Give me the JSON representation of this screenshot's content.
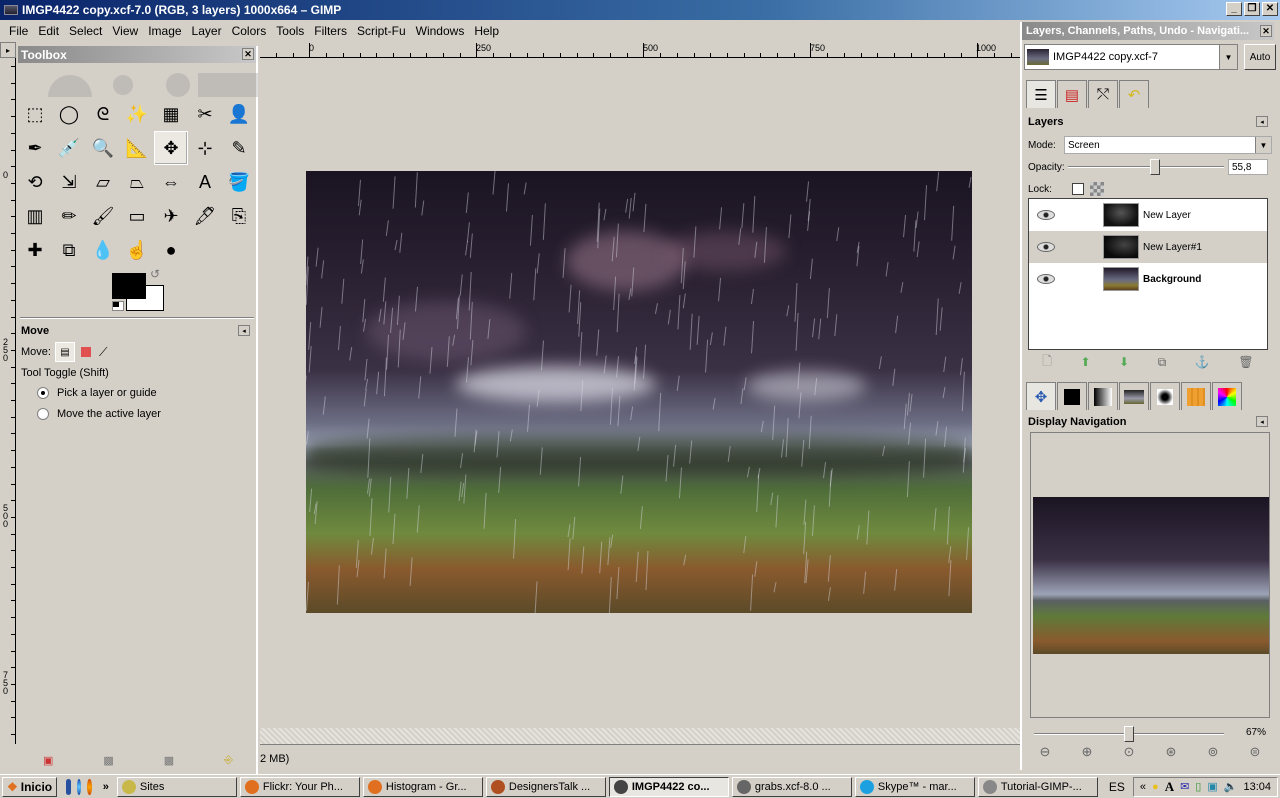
{
  "window": {
    "title": "IMGP4422 copy.xcf-7.0 (RGB, 3 layers) 1000x664 – GIMP",
    "controls": [
      "minimize",
      "restore",
      "close"
    ]
  },
  "menubar": {
    "items": [
      "File",
      "Edit",
      "Select",
      "View",
      "Image",
      "Layer",
      "Colors",
      "Tools",
      "Filters",
      "Script-Fu",
      "Windows",
      "Help"
    ]
  },
  "rulers": {
    "horizontal": [
      "0",
      "250",
      "500",
      "750",
      "1000"
    ],
    "vertical": [
      "0",
      "250",
      "500",
      "750"
    ]
  },
  "toolbox": {
    "title": "Toolbox",
    "tools": [
      {
        "name": "rect-select",
        "glyph": "⬚"
      },
      {
        "name": "ellipse-select",
        "glyph": "◯"
      },
      {
        "name": "free-select",
        "glyph": "ᘓ"
      },
      {
        "name": "fuzzy-select",
        "glyph": "✨"
      },
      {
        "name": "select-by-color",
        "glyph": "▦"
      },
      {
        "name": "scissors",
        "glyph": "✂"
      },
      {
        "name": "foreground-select",
        "glyph": "👤"
      },
      {
        "name": "paths",
        "glyph": "✒"
      },
      {
        "name": "color-picker",
        "glyph": "💉"
      },
      {
        "name": "zoom",
        "glyph": "🔍"
      },
      {
        "name": "measure",
        "glyph": "📐"
      },
      {
        "name": "move",
        "glyph": "✥"
      },
      {
        "name": "align",
        "glyph": "⊹"
      },
      {
        "name": "crop",
        "glyph": "✎"
      },
      {
        "name": "rotate",
        "glyph": "⟲"
      },
      {
        "name": "scale",
        "glyph": "⇲"
      },
      {
        "name": "shear",
        "glyph": "▱"
      },
      {
        "name": "perspective",
        "glyph": "⏢"
      },
      {
        "name": "flip",
        "glyph": "⇔"
      },
      {
        "name": "text",
        "glyph": "A"
      },
      {
        "name": "bucket-fill",
        "glyph": "🪣"
      },
      {
        "name": "blend",
        "glyph": "▥"
      },
      {
        "name": "pencil",
        "glyph": "✏"
      },
      {
        "name": "paintbrush",
        "glyph": "🖌"
      },
      {
        "name": "eraser",
        "glyph": "▭"
      },
      {
        "name": "airbrush",
        "glyph": "✈"
      },
      {
        "name": "ink",
        "glyph": "🖋"
      },
      {
        "name": "clone",
        "glyph": "⎘"
      },
      {
        "name": "heal",
        "glyph": "✚"
      },
      {
        "name": "perspective-clone",
        "glyph": "⧉"
      },
      {
        "name": "blur-sharpen",
        "glyph": "💧"
      },
      {
        "name": "smudge",
        "glyph": "☝"
      },
      {
        "name": "dodge-burn",
        "glyph": "●"
      }
    ],
    "active_tool": "move",
    "fg_color": "#000000",
    "bg_color": "#ffffff",
    "tool_options": {
      "title": "Move",
      "move_label": "Move:",
      "toggle_label": "Tool Toggle  (Shift)",
      "options": [
        {
          "label": "Pick a layer or guide",
          "selected": true
        },
        {
          "label": "Move the active layer",
          "selected": false
        }
      ]
    }
  },
  "statusbar": {
    "text": "2 MB)"
  },
  "dock": {
    "title": "Layers, Channels, Paths, Undo - Navigati...",
    "image_select": "IMGP4422 copy.xcf-7",
    "auto_label": "Auto",
    "tabs": [
      "layers-tab",
      "channels-tab",
      "paths-tab",
      "undo-tab"
    ],
    "layers": {
      "title": "Layers",
      "mode_label": "Mode:",
      "mode_value": "Screen",
      "opacity_label": "Opacity:",
      "opacity_value": "55,8",
      "opacity_fraction": 0.558,
      "lock_label": "Lock:",
      "items": [
        {
          "name": "New Layer",
          "visible": true,
          "bold": false,
          "selected": false
        },
        {
          "name": "New Layer#1",
          "visible": true,
          "bold": false,
          "selected": true
        },
        {
          "name": "Background",
          "visible": true,
          "bold": true,
          "selected": false
        }
      ],
      "buttons": [
        "new-layer",
        "raise-layer",
        "lower-layer",
        "duplicate-layer",
        "anchor-layer",
        "delete-layer"
      ]
    },
    "lower_tabs": [
      "tool-options-tab",
      "colors-tab",
      "gradients-tab",
      "images-tab",
      "brushes-tab",
      "patterns-tab",
      "palettes-tab"
    ],
    "navigation": {
      "title": "Display Navigation",
      "zoom_value": "67%",
      "zoom_fraction": 0.5,
      "buttons": [
        "zoom-out",
        "zoom-in",
        "zoom-1-1",
        "zoom-fit-image",
        "zoom-fit-window",
        "shrink-wrap"
      ]
    }
  },
  "taskbar": {
    "start_label": "Inicio",
    "tasks": [
      {
        "label": "Sites",
        "active": false,
        "color": "#c8b84a"
      },
      {
        "label": "Flickr: Your Ph...",
        "active": false,
        "color": "#e07020"
      },
      {
        "label": "Histogram - Gr...",
        "active": false,
        "color": "#e07020"
      },
      {
        "label": "DesignersTalk ...",
        "active": false,
        "color": "#b05020"
      },
      {
        "label": "IMGP4422 co...",
        "active": true,
        "color": "#444"
      },
      {
        "label": "grabs.xcf-8.0 ...",
        "active": false,
        "color": "#666"
      },
      {
        "label": "Skype™ - mar...",
        "active": false,
        "color": "#1ca0e0"
      },
      {
        "label": "Tutorial-GIMP-...",
        "active": false,
        "color": "#888"
      }
    ],
    "language": "ES",
    "clock": "13:04"
  }
}
